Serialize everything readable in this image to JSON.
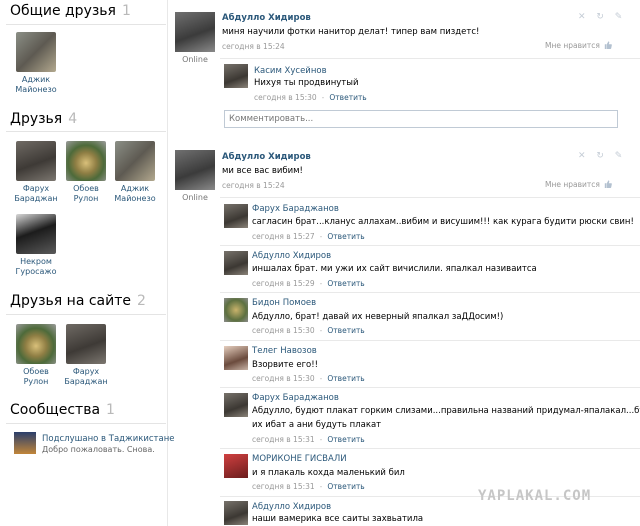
{
  "sidebar": {
    "common_friends": {
      "title": "Общие друзья",
      "count": "1",
      "items": [
        {
          "first": "Аджик",
          "last": "Майонезо"
        }
      ]
    },
    "friends": {
      "title": "Друзья",
      "count": "4",
      "items": [
        {
          "first": "Фарух",
          "last": "Бараджан"
        },
        {
          "first": "Обоев",
          "last": "Рулон"
        },
        {
          "first": "Аджик",
          "last": "Майонезо"
        },
        {
          "first": "Некром",
          "last": "Гуросажо"
        }
      ]
    },
    "online_friends": {
      "title": "Друзья на сайте",
      "count": "2",
      "items": [
        {
          "first": "Обоев",
          "last": "Рулон"
        },
        {
          "first": "Фарух",
          "last": "Бараджан"
        }
      ]
    },
    "communities": {
      "title": "Сообщества",
      "count": "1",
      "items": [
        {
          "name": "Подслушано в Таджикистане",
          "subtitle": "Добро пожаловать. Снова."
        }
      ]
    }
  },
  "posts": [
    {
      "author": "Абдулло Хидиров",
      "text": "миня научили фотки нанитор делат! типер вам пиздетс!",
      "date": "сегодня в 15:24",
      "like_label": "Мне нравится",
      "status": "Online",
      "actions": "✕ ↻ ✎",
      "comments": [
        {
          "author": "Касим Хусейнов",
          "text": "Нихуя ты продвинутый",
          "date": "сегодня в 15:30",
          "reply": "Ответить"
        }
      ],
      "comment_placeholder": "Комментировать..."
    },
    {
      "author": "Абдулло Хидиров",
      "text": "ми все вас вибим!",
      "date": "сегодня в 15:24",
      "like_label": "Мне нравится",
      "status": "Online",
      "actions": "✕ ↻ ✎",
      "comments": [
        {
          "author": "Фарух Бараджанов",
          "text": "сагласин брат...кланус аллахам..вибим и висушим!!! как курага будити рюски свин!",
          "date": "сегодня в 15:27",
          "reply": "Ответить"
        },
        {
          "author": "Абдулло Хидиров",
          "text": "иншалах брат. ми ужи их сайт вичислили. япалкал називаитса",
          "date": "сегодня в 15:29",
          "reply": "Ответить"
        },
        {
          "author": "Бидон Помоев",
          "text": "Абдулло, брат! давай их неверный япалкал заДДосим!)",
          "date": "сегодня в 15:30",
          "reply": "Ответить"
        },
        {
          "author": "Телег Навозов",
          "text": "Взорвите его!!",
          "date": "сегодня в 15:30",
          "reply": "Ответить"
        },
        {
          "author": "Фарух Бараджанов",
          "text_1": "Абдулло, будют плакат горким слизами...правильна названий придумал-япалакал...будим",
          "text_2": "их ибат а ани будуть плакат",
          "date": "сегодня в 15:31",
          "reply": "Ответить"
        },
        {
          "author": "МОРИКОНЕ ГИСВАЛИ",
          "text": "и я плакаль кохда маленький бил",
          "date": "сегодня в 15:31",
          "reply": "Ответить"
        },
        {
          "author": "Абдулло Хидиров",
          "text": "наши вамерика все саиты захвьатила"
        }
      ]
    }
  ],
  "watermark": "YAPLAKAL.COM",
  "colors": {
    "link": "#2b587a",
    "date": "#999999",
    "counter": "#b9b9b9"
  }
}
